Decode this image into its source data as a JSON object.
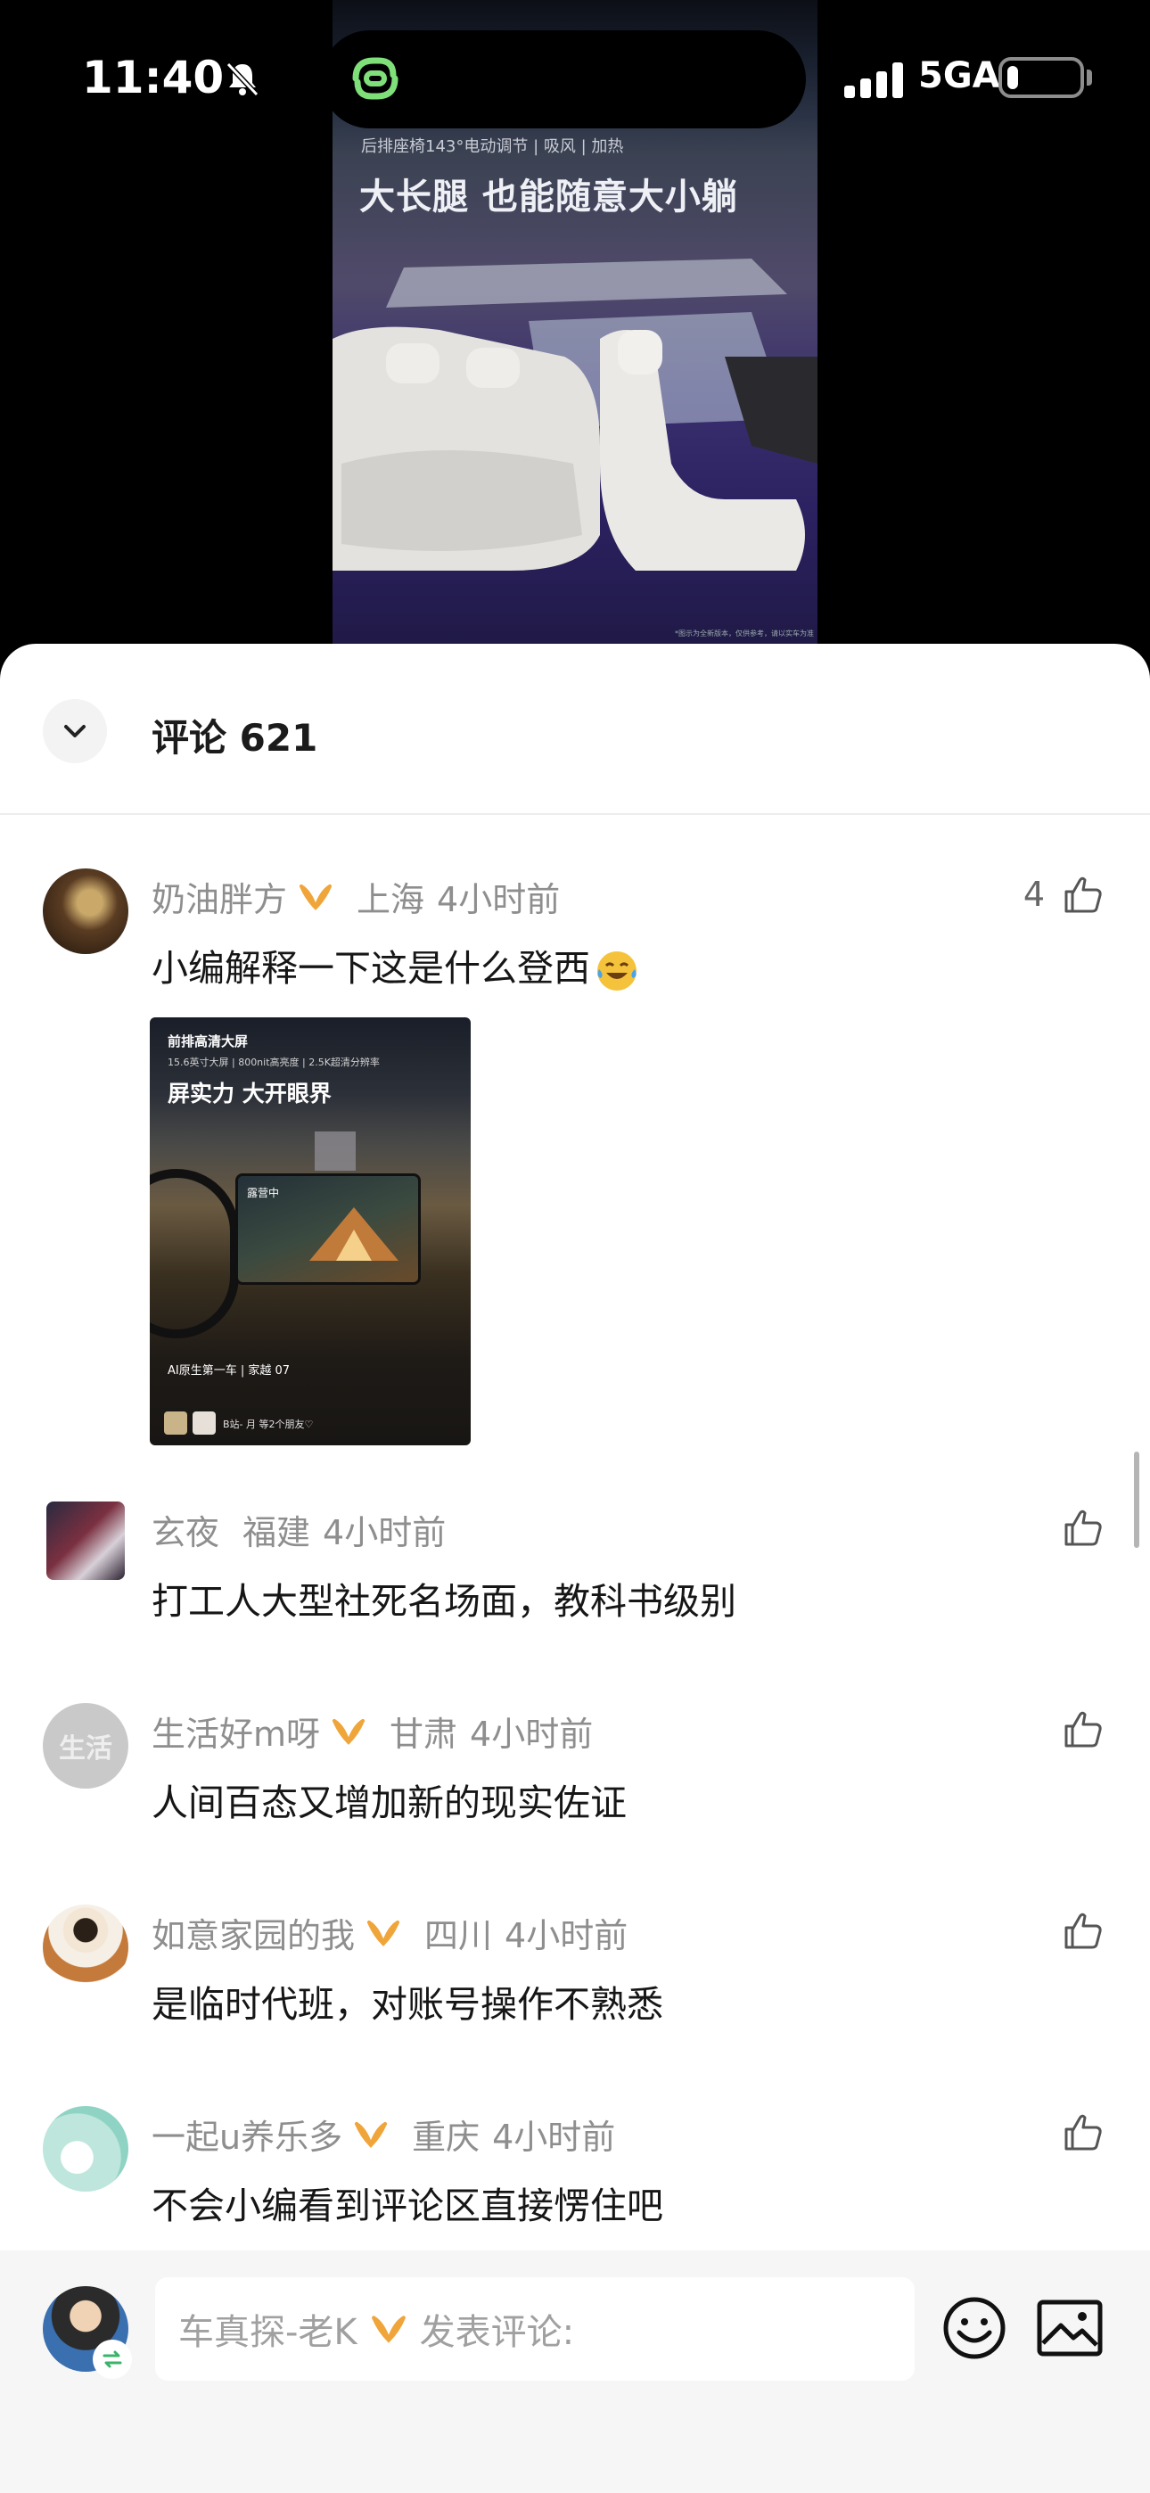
{
  "status_bar": {
    "time": "11:40",
    "network": "5GA",
    "battery_level": 0.15
  },
  "poster": {
    "subtitle": "后排座椅143°电动调节 | 吸风 | 加热",
    "title": "大长腿 也能随意大小躺",
    "fineprint": "*图示为全新版本，仅供参考，请以实车为准"
  },
  "sheet": {
    "title": "评论 621"
  },
  "comments": [
    {
      "user": "奶油胖方",
      "has_badge": true,
      "location": "上海",
      "time": "4小时前",
      "likes": "4",
      "text": "小编解释一下这是什么登西",
      "trailing_emoji": "laughing-crying-emoji",
      "attachment": {
        "heading": "前排高清大屏",
        "spec": "15.6英寸大屏 | 800nit高亮度 | 2.5K超清分辨率",
        "title": "屏实力 大开眼界",
        "screen_text": "露营中",
        "brand": "AI原生第一车 | 家越 07",
        "friends": "B站- 月 等2个朋友♡"
      }
    },
    {
      "user": "玄夜",
      "has_badge": false,
      "location": "福建",
      "time": "4小时前",
      "likes": "",
      "text": "打工人大型社死名场面，教科书级别"
    },
    {
      "user": "生活好m呀",
      "has_badge": true,
      "location": "甘肃",
      "time": "4小时前",
      "likes": "",
      "text": "人间百态又增加新的现实佐证",
      "avatar_text": "生活"
    },
    {
      "user": "如意家园的我",
      "has_badge": true,
      "location": "四川",
      "time": "4小时前",
      "likes": "",
      "text": "是临时代班，对账号操作不熟悉"
    },
    {
      "user": "一起u养乐多",
      "has_badge": true,
      "location": "重庆",
      "time": "4小时前",
      "likes": "",
      "text": "不会小编看到评论区直接愣住吧"
    }
  ],
  "composer": {
    "user": "车真探-老K",
    "placeholder": "发表评论:"
  },
  "colors": {
    "badge": "#f0a53a",
    "island_icon": "#7fe07a",
    "meta_text": "#8e8e8e"
  },
  "icons": [
    "bell-slash-icon",
    "signal-icon",
    "chevron-down-icon",
    "thumb-up-icon",
    "emoji-icon",
    "image-icon",
    "swap-icon"
  ]
}
